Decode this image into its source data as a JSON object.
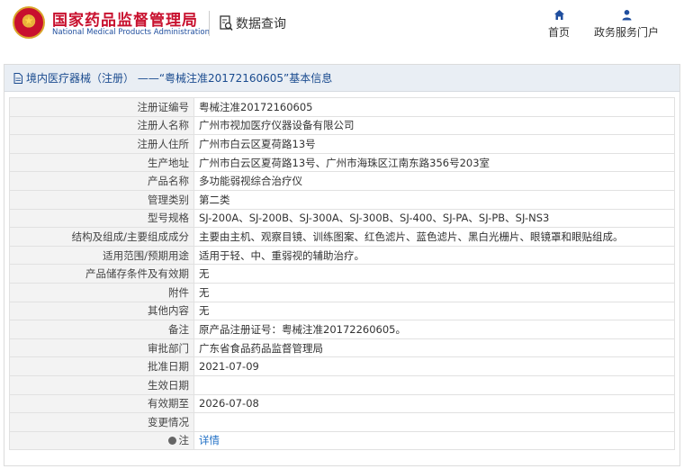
{
  "header": {
    "org_name_cn": "国家药品监督管理局",
    "org_name_en": "National Medical Products Administration",
    "query_title": "数据查询",
    "nav": {
      "home_label": "首页",
      "portal_label": "政务服务门户"
    }
  },
  "panel": {
    "title": "境内医疗器械（注册） ——“粤械注准20172160605”基本信息"
  },
  "rows": [
    {
      "label": "注册证编号",
      "value": "粤械注准20172160605"
    },
    {
      "label": "注册人名称",
      "value": "广州市视加医疗仪器设备有限公司"
    },
    {
      "label": "注册人住所",
      "value": "广州市白云区夏荷路13号"
    },
    {
      "label": "生产地址",
      "value": "广州市白云区夏荷路13号、广州市海珠区江南东路356号203室"
    },
    {
      "label": "产品名称",
      "value": "多功能弱视综合治疗仪"
    },
    {
      "label": "管理类别",
      "value": "第二类"
    },
    {
      "label": "型号规格",
      "value": "SJ-200A、SJ-200B、SJ-300A、SJ-300B、SJ-400、SJ-PA、SJ-PB、SJ-NS3"
    },
    {
      "label": "结构及组成/主要组成成分",
      "value": "主要由主机、观察目镜、训练图案、红色滤片、蓝色滤片、黑白光栅片、眼镜罩和眼贴组成。"
    },
    {
      "label": "适用范围/预期用途",
      "value": "适用于轻、中、重弱视的辅助治疗。"
    },
    {
      "label": "产品储存条件及有效期",
      "value": "无"
    },
    {
      "label": "附件",
      "value": "无"
    },
    {
      "label": "其他内容",
      "value": "无"
    },
    {
      "label": "备注",
      "value": "原产品注册证号：粤械注准20172260605。"
    },
    {
      "label": "审批部门",
      "value": "广东省食品药品监督管理局"
    },
    {
      "label": "批准日期",
      "value": "2021-07-09"
    },
    {
      "label": "生效日期",
      "value": ""
    },
    {
      "label": "有效期至",
      "value": "2026-07-08"
    },
    {
      "label": "变更情况",
      "value": ""
    }
  ],
  "note_row": {
    "label": "注",
    "value": "详情"
  }
}
